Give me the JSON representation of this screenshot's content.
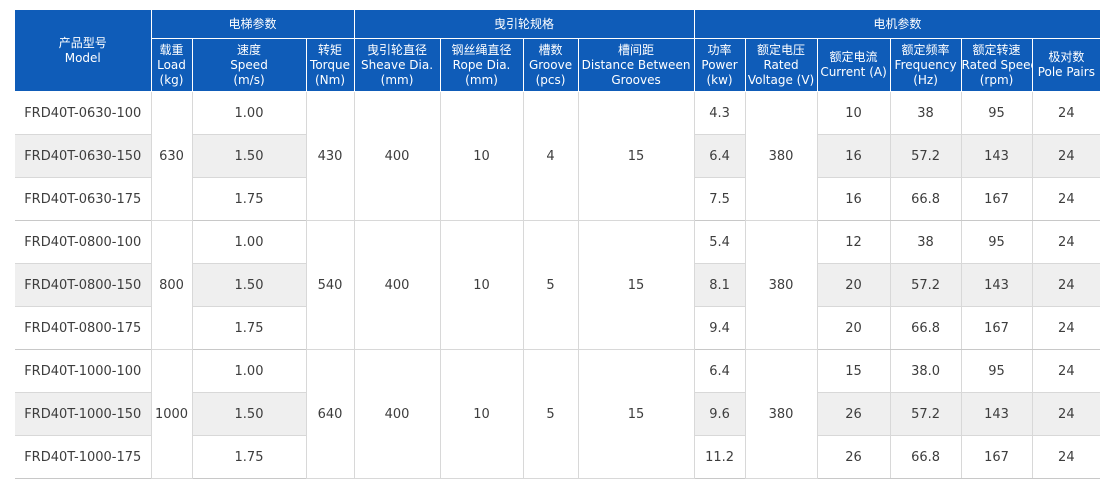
{
  "header": {
    "model": {
      "cn": "产品型号",
      "en": "Model"
    },
    "groups": {
      "elevator": "电梯参数",
      "sheave": "曳引轮规格",
      "motor": "电机参数"
    },
    "cols": {
      "load": {
        "cn": "载重",
        "en1": "Load",
        "en2": "(kg)"
      },
      "speed": {
        "cn": "速度",
        "en1": "Speed",
        "en2": "(m/s)"
      },
      "torque": {
        "cn": "转矩",
        "en1": "Torque",
        "en2": "(Nm)"
      },
      "sheave_dia": {
        "cn": "曳引轮直径",
        "en1": "Sheave Dia.",
        "en2": "(mm)"
      },
      "rope_dia": {
        "cn": "钢丝绳直径",
        "en1": "Rope Dia.",
        "en2": "(mm)"
      },
      "groove": {
        "cn": "槽数",
        "en1": "Groove",
        "en2": "(pcs)"
      },
      "distance": {
        "cn": "槽间距",
        "en1": "Distance Between",
        "en2": "Grooves"
      },
      "power": {
        "cn": "功率",
        "en1": "Power",
        "en2": "(kw)"
      },
      "voltage": {
        "cn": "额定电压",
        "en1": "Rated",
        "en2": "Voltage (V)"
      },
      "current": {
        "cn": "额定电流",
        "en1": "Current (A)",
        "en2": ""
      },
      "frequency": {
        "cn": "额定频率",
        "en1": "Frequency",
        "en2": "(Hz)"
      },
      "rated_speed": {
        "cn": "额定转速",
        "en1": "Rated Speed",
        "en2": "(rpm)"
      },
      "pole_pairs": {
        "cn": "极对数",
        "en1": "Pole Pairs",
        "en2": ""
      }
    }
  },
  "groups": [
    {
      "load": "630",
      "torque": "430",
      "sheave_dia": "400",
      "rope_dia": "10",
      "groove": "4",
      "distance": "15",
      "voltage": "380",
      "rows": [
        {
          "model": "FRD40T-0630-100",
          "speed": "1.00",
          "power": "4.3",
          "current": "10",
          "frequency": "38",
          "rated_speed": "95",
          "pole_pairs": "24"
        },
        {
          "model": "FRD40T-0630-150",
          "speed": "1.50",
          "power": "6.4",
          "current": "16",
          "frequency": "57.2",
          "rated_speed": "143",
          "pole_pairs": "24"
        },
        {
          "model": "FRD40T-0630-175",
          "speed": "1.75",
          "power": "7.5",
          "current": "16",
          "frequency": "66.8",
          "rated_speed": "167",
          "pole_pairs": "24"
        }
      ]
    },
    {
      "load": "800",
      "torque": "540",
      "sheave_dia": "400",
      "rope_dia": "10",
      "groove": "5",
      "distance": "15",
      "voltage": "380",
      "rows": [
        {
          "model": "FRD40T-0800-100",
          "speed": "1.00",
          "power": "5.4",
          "current": "12",
          "frequency": "38",
          "rated_speed": "95",
          "pole_pairs": "24"
        },
        {
          "model": "FRD40T-0800-150",
          "speed": "1.50",
          "power": "8.1",
          "current": "20",
          "frequency": "57.2",
          "rated_speed": "143",
          "pole_pairs": "24"
        },
        {
          "model": "FRD40T-0800-175",
          "speed": "1.75",
          "power": "9.4",
          "current": "20",
          "frequency": "66.8",
          "rated_speed": "167",
          "pole_pairs": "24"
        }
      ]
    },
    {
      "load": "1000",
      "torque": "640",
      "sheave_dia": "400",
      "rope_dia": "10",
      "groove": "5",
      "distance": "15",
      "voltage": "380",
      "rows": [
        {
          "model": "FRD40T-1000-100",
          "speed": "1.00",
          "power": "6.4",
          "current": "15",
          "frequency": "38.0",
          "rated_speed": "95",
          "pole_pairs": "24"
        },
        {
          "model": "FRD40T-1000-150",
          "speed": "1.50",
          "power": "9.6",
          "current": "26",
          "frequency": "57.2",
          "rated_speed": "143",
          "pole_pairs": "24"
        },
        {
          "model": "FRD40T-1000-175",
          "speed": "1.75",
          "power": "11.2",
          "current": "26",
          "frequency": "66.8",
          "rated_speed": "167",
          "pole_pairs": "24"
        }
      ]
    }
  ]
}
